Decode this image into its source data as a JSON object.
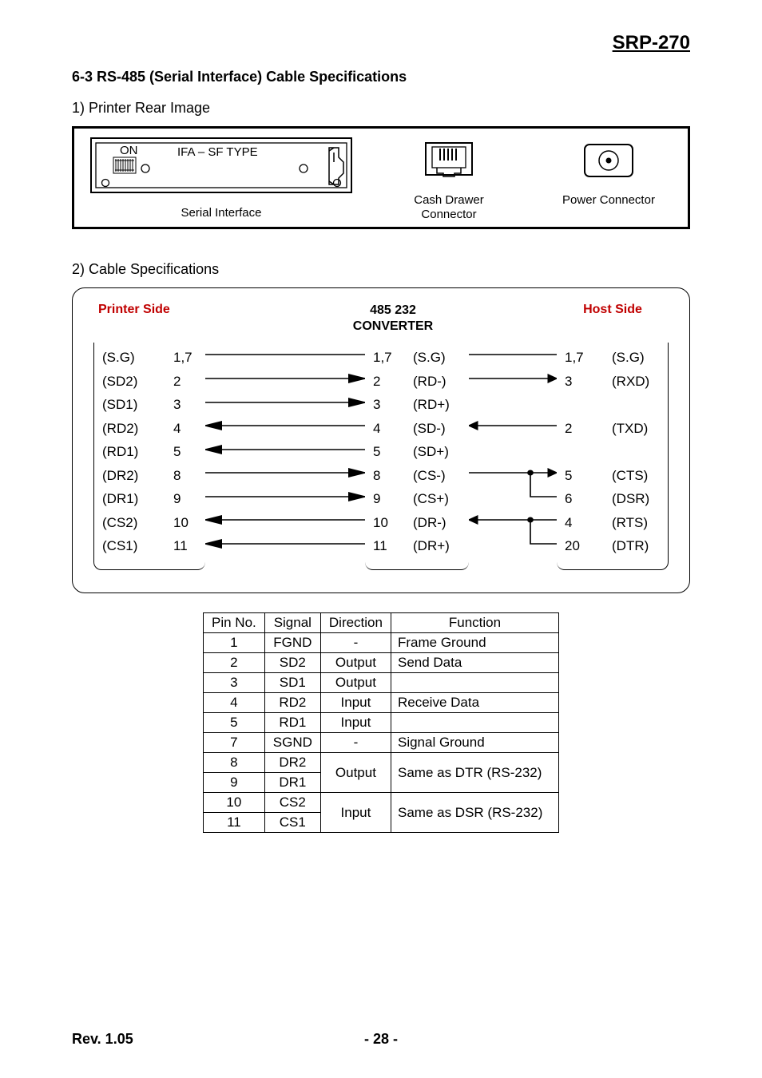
{
  "doc_title": "SRP-270",
  "section_heading": "6-3 RS-485 (Serial Interface) Cable Specifications",
  "sub1": "1) Printer Rear Image",
  "rear": {
    "on_label": "ON",
    "ifa_label": "IFA – SF TYPE",
    "serial": "Serial Interface",
    "drawer": "Cash Drawer\nConnector",
    "power": "Power Connector"
  },
  "sub2": "2) Cable Specifications",
  "titles": {
    "printer": "Printer Side",
    "converter_top": "485   232",
    "converter_bottom": "CONVERTER",
    "host": "Host Side"
  },
  "printer_pins": [
    {
      "sig": "(S.G)",
      "num": "1,7"
    },
    {
      "sig": "(SD2)",
      "num": "2"
    },
    {
      "sig": "(SD1)",
      "num": "3"
    },
    {
      "sig": "(RD2)",
      "num": "4"
    },
    {
      "sig": "(RD1)",
      "num": "5"
    },
    {
      "sig": "(DR2)",
      "num": "8"
    },
    {
      "sig": "(DR1)",
      "num": "9"
    },
    {
      "sig": "(CS2)",
      "num": "10"
    },
    {
      "sig": "(CS1)",
      "num": "11"
    }
  ],
  "converter_pins": [
    {
      "num": "1,7",
      "sig": "(S.G)"
    },
    {
      "num": "2",
      "sig": "(RD-)"
    },
    {
      "num": "3",
      "sig": "(RD+)"
    },
    {
      "num": "4",
      "sig": "(SD-)"
    },
    {
      "num": "5",
      "sig": "(SD+)"
    },
    {
      "num": "8",
      "sig": "(CS-)"
    },
    {
      "num": "9",
      "sig": "(CS+)"
    },
    {
      "num": "10",
      "sig": "(DR-)"
    },
    {
      "num": "11",
      "sig": "(DR+)"
    }
  ],
  "host_pins": [
    {
      "num": "1,7",
      "sig": "(S.G)"
    },
    {
      "num": "3",
      "sig": "(RXD)"
    },
    {
      "num": "",
      "sig": ""
    },
    {
      "num": "2",
      "sig": "(TXD)"
    },
    {
      "num": "",
      "sig": ""
    },
    {
      "num": "5",
      "sig": "(CTS)"
    },
    {
      "num": "6",
      "sig": "(DSR)"
    },
    {
      "num": "4",
      "sig": "(RTS)"
    },
    {
      "num": "20",
      "sig": "(DTR)"
    }
  ],
  "table": {
    "headers": [
      "Pin No.",
      "Signal",
      "Direction",
      "Function"
    ],
    "rows": [
      [
        "1",
        "FGND",
        "-",
        "Frame Ground"
      ],
      [
        "2",
        "SD2",
        "Output",
        "Send Data"
      ],
      [
        "3",
        "SD1",
        "Output",
        ""
      ],
      [
        "4",
        "RD2",
        "Input",
        "Receive Data"
      ],
      [
        "5",
        "RD1",
        "Input",
        ""
      ],
      [
        "7",
        "SGND",
        "-",
        "Signal Ground"
      ]
    ],
    "merged": [
      {
        "pins": [
          "8",
          "9"
        ],
        "sigs": [
          "DR2",
          "DR1"
        ],
        "dir": "Output",
        "func": "Same as DTR (RS-232)"
      },
      {
        "pins": [
          "10",
          "11"
        ],
        "sigs": [
          "CS2",
          "CS1"
        ],
        "dir": "Input",
        "func": "Same as DSR (RS-232)"
      }
    ]
  },
  "footer": {
    "rev": "Rev. 1.05",
    "page": "- 28 -"
  }
}
